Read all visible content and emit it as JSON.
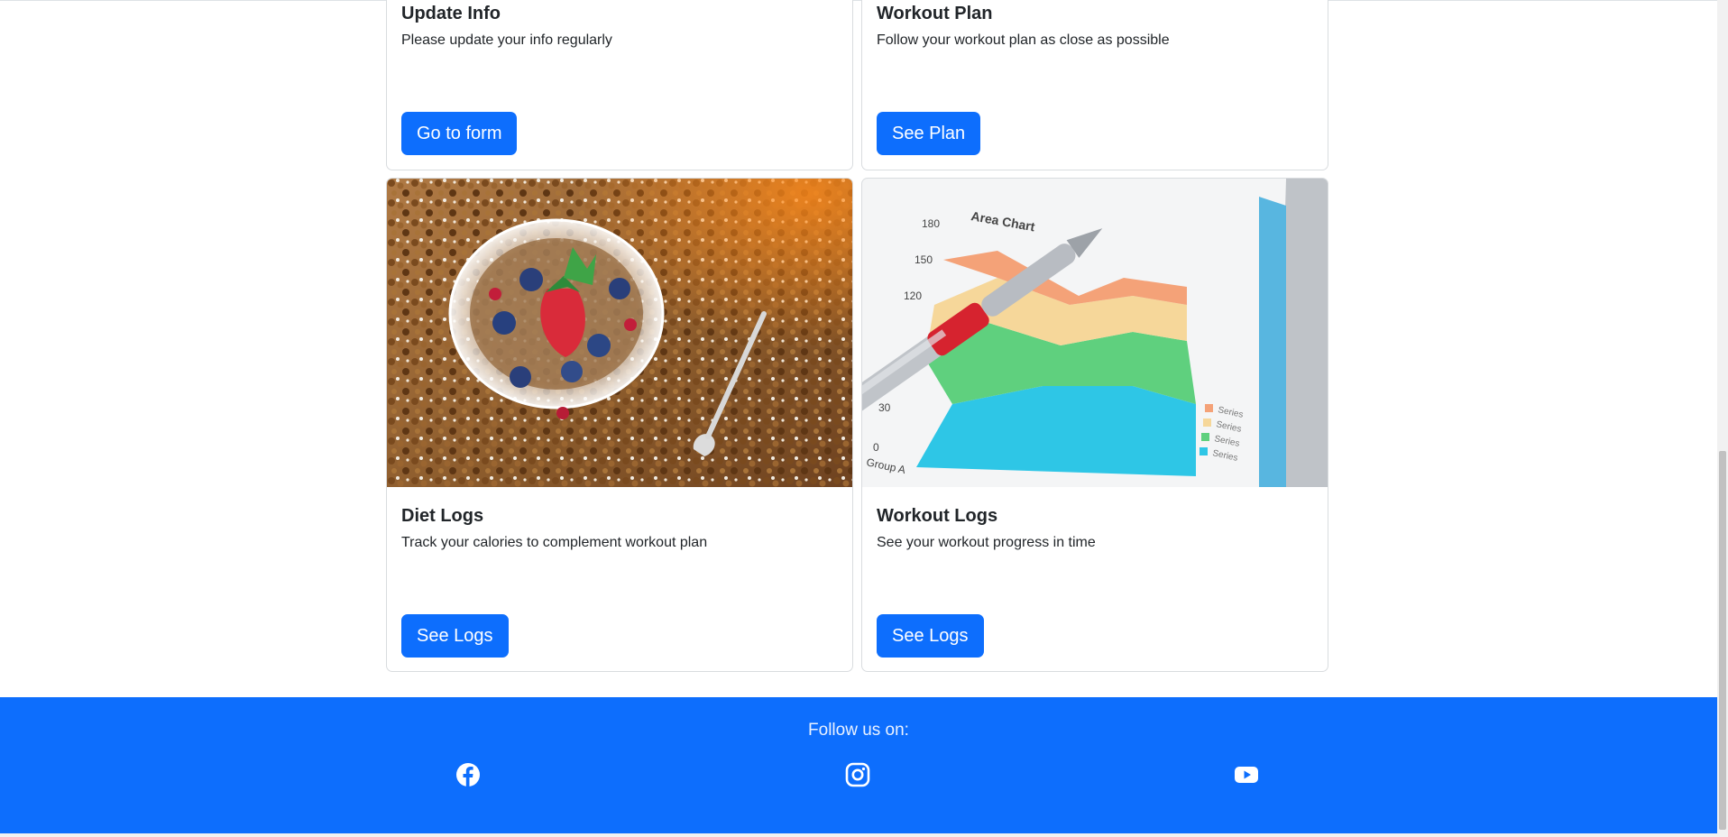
{
  "cards": [
    {
      "title": "Update Info",
      "text": "Please update your info regularly",
      "button": "Go to form"
    },
    {
      "title": "Workout Plan",
      "text": "Follow your workout plan as close as possible",
      "button": "See Plan"
    },
    {
      "title": "Diet Logs",
      "text": "Track your calories to complement workout plan",
      "button": "See Logs",
      "image": "granola-bowl-image"
    },
    {
      "title": "Workout Logs",
      "text": "See your workout progress in time",
      "button": "See Logs",
      "image": "area-chart-image",
      "image_text": {
        "chart_title": "Area Chart",
        "ticks": [
          "180",
          "150",
          "120",
          "30",
          "0"
        ],
        "group": "Group A",
        "legend": [
          "Series",
          "Series",
          "Series",
          "Series"
        ]
      }
    }
  ],
  "footer": {
    "title": "Follow us on:",
    "social": [
      "facebook-icon",
      "instagram-icon",
      "youtube-icon"
    ]
  },
  "colors": {
    "primary": "#0d6efd",
    "text": "#212529",
    "border": "#d9dcdf"
  }
}
